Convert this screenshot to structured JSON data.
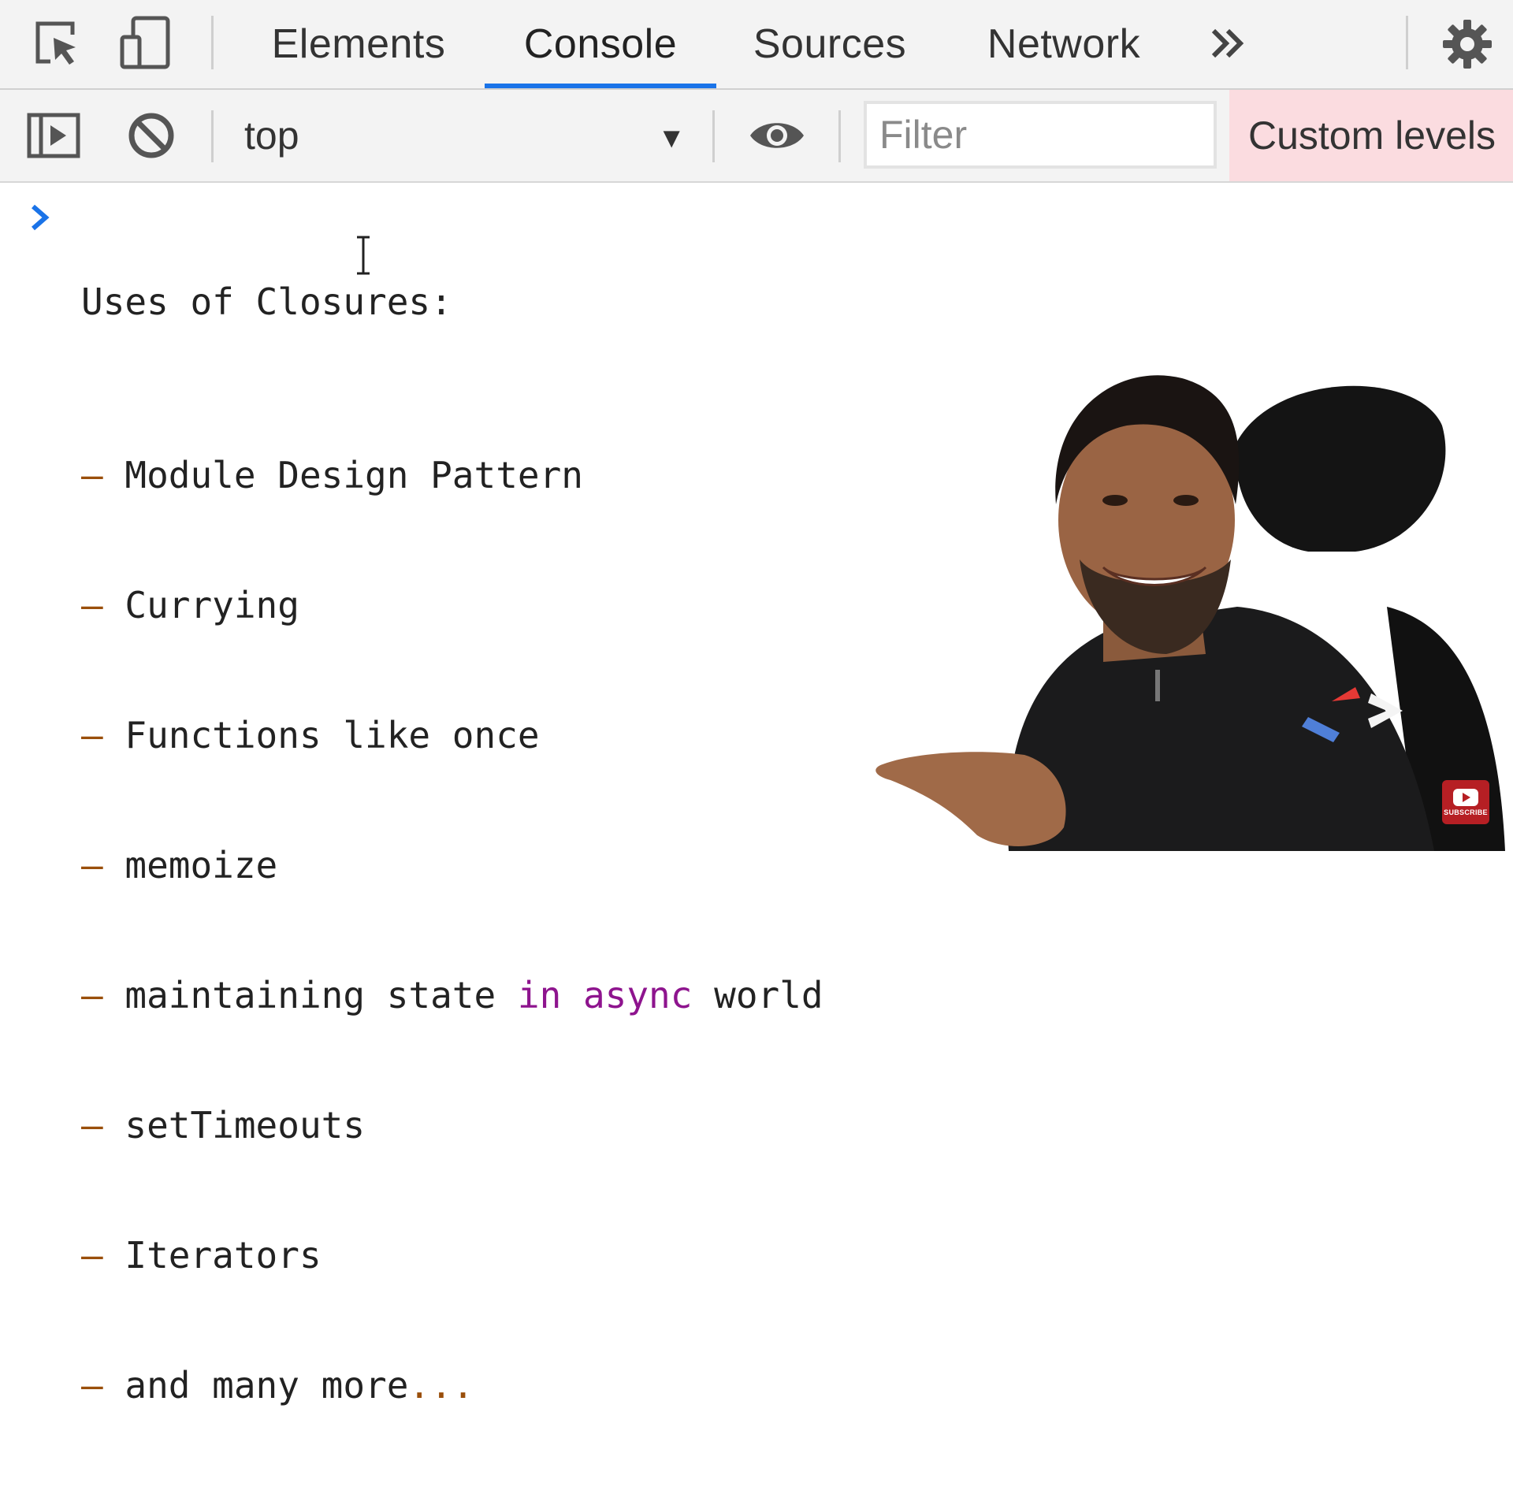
{
  "devtools": {
    "tabs": [
      {
        "label": "Elements"
      },
      {
        "label": "Console"
      },
      {
        "label": "Sources"
      },
      {
        "label": "Network"
      }
    ],
    "active_tab": "Console",
    "toolbar": {
      "context": "top",
      "filter_placeholder": "Filter",
      "levels_label": "Custom levels"
    },
    "accent_color": "#1a73e8",
    "levels_bg_color": "#fbdce0",
    "icons": [
      "select-element-icon",
      "device-toolbar-icon",
      "more-tabs-icon",
      "settings-gear-icon",
      "sidebar-toggle-icon",
      "clear-console-icon",
      "dropdown-arrow-icon",
      "live-expression-eye-icon",
      "prompt-chevron-icon",
      "text-cursor-icon"
    ]
  },
  "console": {
    "heading": "Uses of Closures:",
    "items": [
      {
        "dash": "– ",
        "text": "Module Design Pattern"
      },
      {
        "dash": "– ",
        "text": "Currying"
      },
      {
        "dash": "– ",
        "text": "Functions like once"
      },
      {
        "dash": "– ",
        "text": "memoize"
      },
      {
        "dash": "– ",
        "text_before": "maintaining state ",
        "keyword": "in async",
        "text_after": " world"
      },
      {
        "dash": "– ",
        "text": "setTimeouts"
      },
      {
        "dash": "– ",
        "text": "Iterators"
      },
      {
        "dash": "– ",
        "text": "and many more",
        "ellipsis": "..."
      }
    ]
  },
  "overlay": {
    "subscribe_label": "SUBSCRIBE"
  }
}
